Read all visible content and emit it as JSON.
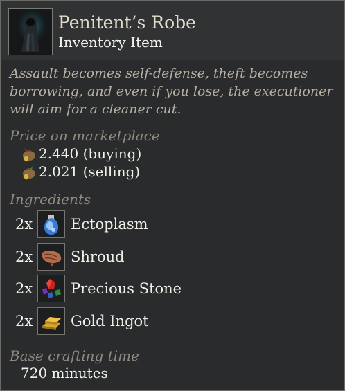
{
  "item": {
    "title": "Penitent’s Robe",
    "subtitle": "Inventory Item",
    "description": "Assault becomes self-defense, theft becomes borrowing, and even if you lose, the executioner will aim for a cleaner cut.",
    "icon": "penitent-robe-icon"
  },
  "marketplace": {
    "label": "Price on marketplace",
    "buying": "2.440 (buying)",
    "selling": "2.021 (selling)",
    "icon_buy": "coin-pouch-buy-icon",
    "icon_sell": "coin-pouch-sell-icon"
  },
  "ingredients": {
    "label": "Ingredients",
    "items": [
      {
        "qty": "2x",
        "name": "Ectoplasm",
        "icon": "ectoplasm-icon"
      },
      {
        "qty": "2x",
        "name": "Shroud",
        "icon": "shroud-icon"
      },
      {
        "qty": "2x",
        "name": "Precious Stone",
        "icon": "precious-stone-icon"
      },
      {
        "qty": "2x",
        "name": "Gold Ingot",
        "icon": "gold-ingot-icon"
      }
    ]
  },
  "crafting": {
    "label": "Base crafting time",
    "value": "720 minutes"
  },
  "colors": {
    "background": "#2a2b2c",
    "header": "#313234",
    "title": "#e4dccd",
    "muted": "#8f8a80",
    "text": "#f1efe9"
  }
}
